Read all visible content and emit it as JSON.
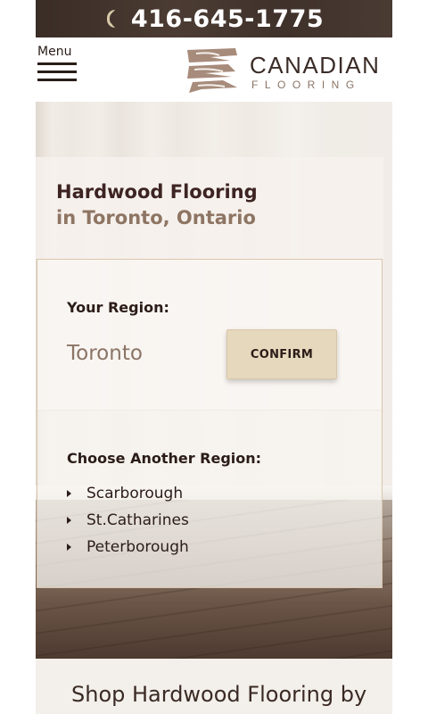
{
  "topbar": {
    "phone_icon": "phone-icon",
    "phone": "416-645-1775"
  },
  "header": {
    "menu_label": "Menu",
    "menu_icon": "hamburger-icon",
    "logo": {
      "title": "CANADIAN",
      "subtitle": "FLOORING"
    }
  },
  "hero": {
    "title_line1": "Hardwood Flooring",
    "title_line2": "in Toronto, Ontario"
  },
  "region_picker": {
    "your_region_label": "Your Region:",
    "current_region": "Toronto",
    "confirm_label": "CONFIRM",
    "choose_label": "Choose Another Region:",
    "other_regions": [
      "Scarborough",
      "St.Catharines",
      "Peterborough"
    ]
  },
  "shop": {
    "heading": "Shop Hardwood Flooring by"
  },
  "colors": {
    "brand_dark": "#3d2422",
    "brand_taupe": "#8e7563",
    "button_bg": "#e6d8bd",
    "topbar_bg": "#3f322b"
  }
}
